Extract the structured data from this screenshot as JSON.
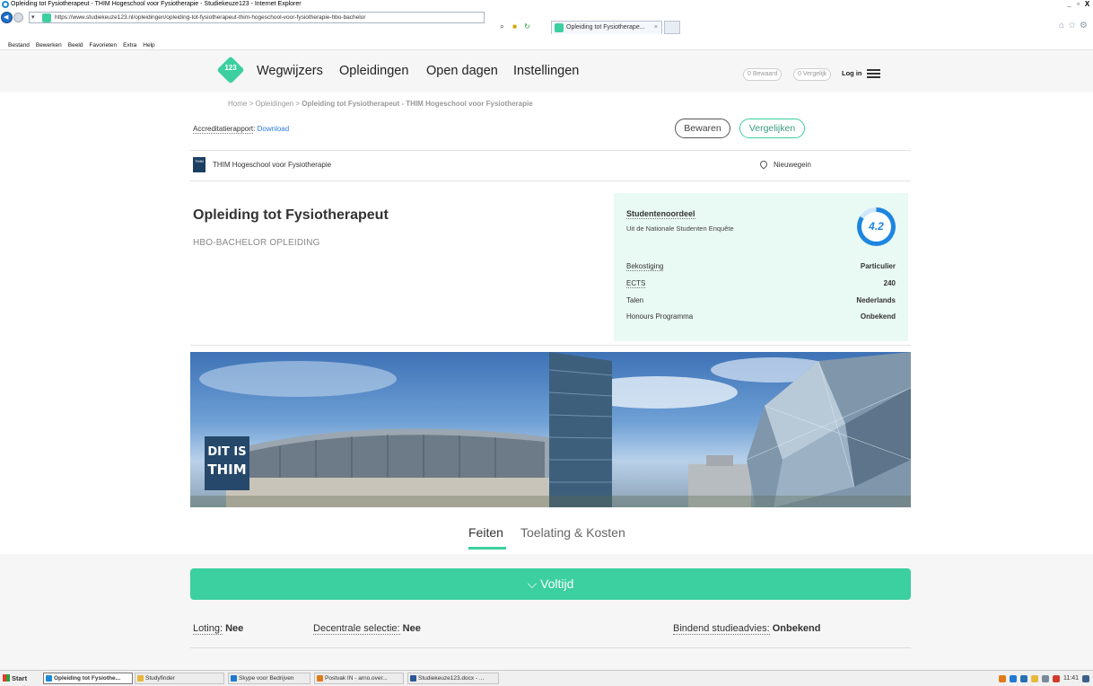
{
  "window": {
    "title": "Opleiding tot Fysiotherapeut - THIM Hogeschool voor Fysiotherapie - Studiekeuze123 - Internet Explorer",
    "controls": [
      "_",
      "▫",
      "X"
    ]
  },
  "browser": {
    "url": "https://www.studiekeuze123.nl/opleidingen/opleiding-tot-fysiotherapeut-thim-hogeschool-voor-fysiotherapie-hbo-bachelor",
    "tab_title": "Opleiding tot Fysiotherape...",
    "tab_close": "×",
    "menu": [
      "Bestand",
      "Bewerken",
      "Beeld",
      "Favorieten",
      "Extra",
      "Help"
    ]
  },
  "site_header": {
    "logo_text": "123",
    "nav": [
      "Wegwijzers",
      "Opleidingen",
      "Open dagen",
      "Instellingen"
    ],
    "bewaard": "0 Bewaard",
    "vergelijk": "0 Vergelijk",
    "login": "Log in"
  },
  "breadcrumb": {
    "home": "Home",
    "sep": " > ",
    "level2": "Opleidingen",
    "current": "Opleiding tot Fysiotherapeut - THIM Hogeschool voor Fysiotherapie"
  },
  "accreditation": {
    "label": "Accreditatierapport",
    "colon": ":",
    "link": "Download"
  },
  "actions": {
    "save": "Bewaren",
    "compare": "Vergelijken"
  },
  "institution": {
    "logo_text": "THIM",
    "name": "THIM Hogeschool voor Fysiotherapie",
    "location": "Nieuwegein"
  },
  "program": {
    "title": "Opleiding tot Fysiotherapeut",
    "type": "HBO-BACHELOR OPLEIDING"
  },
  "infobox": {
    "student_rating_label": "Studentenoordeel",
    "student_rating_source": "Uit de Nationale Studenten Enquête",
    "score": "4.2",
    "score_fraction": 0.84,
    "facts": [
      {
        "key": "Bekostiging",
        "value": "Particulier"
      },
      {
        "key": "ECTS",
        "value": "240"
      },
      {
        "key": "Talen",
        "value": "Nederlands"
      },
      {
        "key": "Honours Programma",
        "value": "Onbekend"
      }
    ]
  },
  "hero": {
    "sign_line1": "DIT IS",
    "sign_line2": "THIM"
  },
  "tabs": {
    "feiten": "Feiten",
    "toelating": "Toelating & Kosten"
  },
  "voltijd": {
    "chevron": "⌵",
    "label": "Voltijd"
  },
  "admission": {
    "loting_label": "Loting:",
    "loting_value": "Nee",
    "decentraal_label": "Decentrale selectie:",
    "decentraal_value": "Nee",
    "bsa_label": "Bindend studieadvies:",
    "bsa_value": "Onbekend"
  },
  "taskbar": {
    "start": "Start",
    "tasks": [
      {
        "label": "Opleiding tot Fysiothe...",
        "icon_color": "#1e8ad6"
      },
      {
        "label": "Studyfinder",
        "icon_color": "#e8b83a"
      },
      {
        "label": "Skype voor Bedrijven",
        "icon_color": "#1f7ad0"
      },
      {
        "label": "Postvak IN - arno.over...",
        "icon_color": "#e07b1a"
      },
      {
        "label": "Studiekeuze123.docx - ...",
        "icon_color": "#2b5797"
      }
    ],
    "clock": "11:41"
  },
  "colors": {
    "brand_green": "#3ccfa0",
    "score_blue": "#1d86e0",
    "infobox_bg": "#e9f9f4",
    "link_blue": "#2a7de1"
  }
}
